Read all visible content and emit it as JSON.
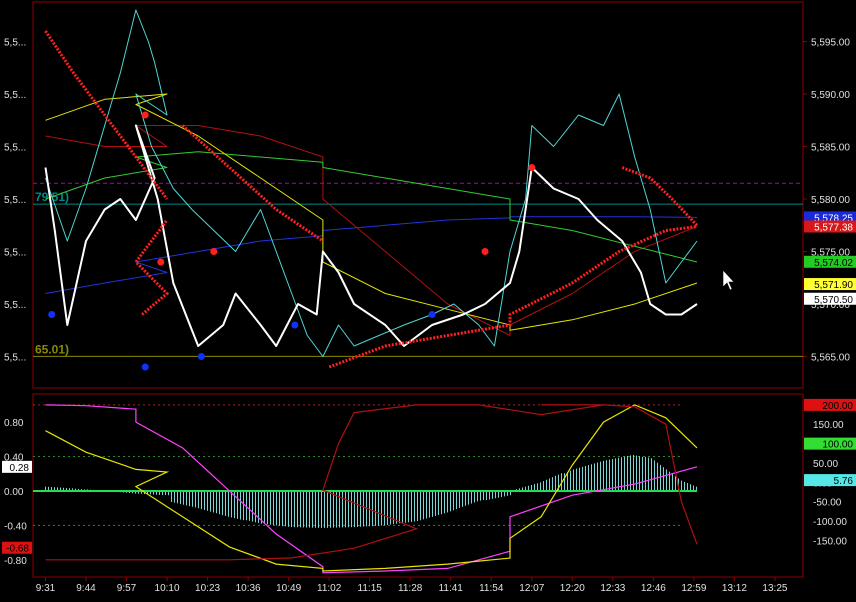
{
  "colors": {
    "background": "#000000",
    "frame": "#8b0000",
    "axis_text": "#e0e0e0",
    "price": "#ffffff",
    "cyan": "#4fd6d6",
    "yellow": "#e6e600",
    "green": "#33cc33",
    "blue": "#2233dd",
    "darkred": "#b01010",
    "red_dots": "#ff2020",
    "blue_dots": "#1030ff",
    "magenta": "#ff40ff",
    "hist": "#7fdede",
    "hline_olive": "#8a8a00",
    "hline_teal": "#008a8a",
    "hline_magenta": "#b000b0",
    "hline_green_dash": "#2a8a2a",
    "hline_red_dash": "#aa2222"
  },
  "chart_data": [
    {
      "panel": "price",
      "type": "line",
      "ylim": [
        5562.0,
        5598.0
      ],
      "right_ticks": [
        "5,595.00",
        "5,590.00",
        "5,585.00",
        "5,580.00",
        "5,575.00",
        "5,570.00",
        "5,565.00"
      ],
      "right_tick_values": [
        5595,
        5590,
        5585,
        5580,
        5575,
        5570,
        5565
      ],
      "left_ticks": [
        "5,5...",
        "5,5...",
        "5,5...",
        "5,5...",
        "5,5...",
        "5,5...",
        "5,5..."
      ],
      "left_tick_values": [
        5595,
        5590,
        5585,
        5580,
        5575,
        5570,
        5565
      ],
      "horizontal_lines": [
        {
          "y": 5565.01,
          "color": "hline_olive",
          "label": "65.01)"
        },
        {
          "y": 5579.51,
          "color": "hline_teal",
          "label": "79.51)"
        },
        {
          "y": 5581.5,
          "color": "hline_magenta",
          "dash": true
        }
      ],
      "value_badges": [
        {
          "text": "5,578.25",
          "bg": "#1a2ad8",
          "fg": "#ffffff",
          "y": 5578.25
        },
        {
          "text": "5,577.38",
          "bg": "#d81818",
          "fg": "#ffffff",
          "y": 5577.38
        },
        {
          "text": "5,574.02",
          "bg": "#22cc22",
          "fg": "#000000",
          "y": 5574.02
        },
        {
          "text": "5,571.90",
          "bg": "#ffff33",
          "fg": "#000000",
          "y": 5571.9
        },
        {
          "text": "5,570.50",
          "bg": "#ffffff",
          "fg": "#000000",
          "y": 5570.5
        }
      ],
      "series": [
        {
          "color": "price",
          "width": 2,
          "x": [
            9.31,
            9.34,
            9.38,
            9.44,
            9.5,
            9.55,
            9.6,
            9.66,
            10.0,
            10.07,
            10.12,
            10.2,
            10.28,
            10.32,
            10.4,
            10.45,
            10.52,
            10.58,
            11.0,
            11.05,
            11.1,
            11.2,
            11.26,
            11.35,
            11.45,
            11.52,
            11.6,
            12.03,
            12.07,
            12.14,
            12.22,
            12.28,
            12.36,
            12.42,
            12.45,
            12.5,
            12.55,
            12.6
          ],
          "y": [
            5583,
            5577,
            5568,
            5576,
            5579,
            5580,
            5578,
            5582,
            5587,
            5580,
            5572,
            5566,
            5568,
            5571,
            5568,
            5566,
            5570,
            5569,
            5575,
            5573,
            5570,
            5568,
            5566,
            5568,
            5569,
            5570,
            5572,
            5575,
            5583,
            5581,
            5580,
            5578,
            5576,
            5573,
            5570,
            5569,
            5569,
            5570
          ]
        },
        {
          "color": "cyan",
          "width": 1,
          "x": [
            9.31,
            9.38,
            9.44,
            9.5,
            9.55,
            9.6,
            9.64,
            9.66,
            9.7,
            10.0,
            10.05,
            10.12,
            10.18,
            10.25,
            10.32,
            10.4,
            10.45,
            10.5,
            10.55,
            11.0,
            11.05,
            11.1,
            11.18,
            11.26,
            11.35,
            11.42,
            11.5,
            11.55,
            12.0,
            12.05,
            12.07,
            12.14,
            12.22,
            12.3,
            12.35,
            12.4,
            12.45,
            12.5,
            12.55,
            12.6
          ],
          "y": [
            5582,
            5576,
            5581,
            5587,
            5592,
            5598,
            5595,
            5593,
            5588,
            5590,
            5585,
            5581,
            5579,
            5577,
            5575,
            5579,
            5575,
            5571,
            5567,
            5565,
            5568,
            5566,
            5567,
            5568,
            5569,
            5570,
            5568,
            5566,
            5575,
            5580,
            5587,
            5585,
            5588,
            5587,
            5590,
            5584,
            5579,
            5572,
            5574,
            5576
          ]
        },
        {
          "color": "yellow",
          "width": 1,
          "x": [
            9.31,
            9.5,
            9.7,
            10.0,
            10.2,
            10.4,
            10.6,
            11.0,
            11.2,
            11.4,
            11.6,
            12.0,
            12.2,
            12.4,
            12.6
          ],
          "y": [
            5587.5,
            5589.5,
            5590,
            5589,
            5586,
            5582,
            5578,
            5574,
            5571,
            5569.5,
            5568,
            5567.5,
            5568.5,
            5570,
            5572
          ]
        },
        {
          "color": "green",
          "width": 1,
          "x": [
            9.31,
            9.5,
            9.7,
            10.0,
            10.2,
            10.4,
            10.6,
            11.0,
            11.2,
            11.4,
            11.6,
            12.0,
            12.2,
            12.4,
            12.6
          ],
          "y": [
            5580,
            5582,
            5583,
            5584,
            5584.5,
            5584,
            5583.5,
            5583,
            5582,
            5581,
            5580,
            5578,
            5577,
            5575.5,
            5574
          ]
        },
        {
          "color": "blue",
          "width": 1,
          "x": [
            9.31,
            9.5,
            9.7,
            10.0,
            10.2,
            10.4,
            10.6,
            11.0,
            11.2,
            11.4,
            11.6,
            12.0,
            12.2,
            12.4,
            12.6
          ],
          "y": [
            5571,
            5572,
            5573,
            5574,
            5575,
            5576,
            5576.5,
            5577,
            5577.5,
            5578,
            5578.2,
            5578.3,
            5578.3,
            5578.3,
            5578.25
          ]
        },
        {
          "color": "darkred",
          "width": 1,
          "x": [
            9.31,
            9.5,
            9.7,
            10.0,
            10.2,
            10.4,
            10.6,
            11.0,
            11.2,
            11.4,
            11.6,
            12.0,
            12.2,
            12.4,
            12.6
          ],
          "y": [
            5586,
            5585,
            5585,
            5587,
            5587,
            5586,
            5584,
            5580,
            5575,
            5570,
            5567,
            5568,
            5571,
            5575,
            5577.38
          ]
        }
      ],
      "markers": {
        "red_trail_a_x": [
          9.31,
          9.4,
          9.5,
          9.6,
          9.7
        ],
        "red_trail_a_y": [
          5596,
          5592,
          5588,
          5584,
          5580
        ],
        "red_trail_b_x": [
          9.62,
          9.7,
          10.0,
          10.1
        ],
        "red_trail_b_y": [
          5569,
          5571,
          5574,
          5578
        ],
        "red_trail_c_x": [
          10.15,
          10.3,
          10.45,
          10.6
        ],
        "red_trail_c_y": [
          5587,
          5583,
          5579,
          5576
        ],
        "red_trail_d_x": [
          11.02,
          11.2,
          11.4,
          11.6,
          12.0,
          12.2,
          12.35,
          12.5,
          12.6
        ],
        "red_trail_d_y": [
          5564,
          5566,
          5567,
          5568,
          5569,
          5572,
          5575,
          5577,
          5577.38
        ],
        "red_trail_e_x": [
          12.36,
          12.45,
          12.52,
          12.6
        ],
        "red_trail_e_y": [
          5583,
          5582,
          5580,
          5577.5
        ],
        "red_dots_x": [
          9.63,
          10.08,
          10.25,
          11.52,
          12.07
        ],
        "red_dots_y": [
          5588,
          5574,
          5575,
          5575,
          5583
        ],
        "blue_dots_x": [
          9.33,
          10.03,
          10.21,
          10.51,
          10.95
        ],
        "blue_dots_y": [
          5569,
          5564,
          5565,
          5568,
          5569
        ]
      }
    },
    {
      "panel": "oscillator",
      "type": "line",
      "ylim": [
        -1.0,
        1.08
      ],
      "left_ticks": [
        "0.80",
        "0.40",
        "0.00",
        "-0.40",
        "-0.80"
      ],
      "left_tick_values": [
        0.8,
        0.4,
        0.0,
        -0.4,
        -0.8
      ],
      "right_ticks": [
        "150.00",
        "100.00",
        "50.00",
        "0.00",
        "-50.00",
        "-100.00",
        "-150.00"
      ],
      "right_tick_values": [
        150,
        100,
        50,
        0,
        -50,
        -100,
        -150
      ],
      "right_range": [
        -200,
        200
      ],
      "left_badges": [
        {
          "text": "0.28",
          "bg": "#ffffff",
          "fg": "#000000",
          "y": 0.28
        },
        {
          "text": "-0.68",
          "bg": "#dd1111",
          "fg": "#000000",
          "y": -0.66
        }
      ],
      "right_badges": [
        {
          "text": "200.00",
          "bg": "#dd1111",
          "fg": "#000000",
          "y": 200
        },
        {
          "text": "100.00",
          "bg": "#33dd33",
          "fg": "#000000",
          "y": 100
        },
        {
          "text": "5.76",
          "bg": "#55e6e6",
          "fg": "#000000",
          "y": 5.76
        }
      ],
      "dashed_lines": [
        {
          "y": 1.0,
          "color": "hline_red_dash"
        },
        {
          "y": 0.4,
          "color": "hline_green_dash"
        },
        {
          "y": 0.0,
          "color": "hline_red_dash"
        },
        {
          "y": -0.4,
          "color": "hline_green_dash"
        }
      ],
      "histogram": {
        "x": [
          9.31,
          9.4,
          9.5,
          9.6,
          9.7,
          10.0,
          10.1,
          10.2,
          10.3,
          10.4,
          10.5,
          10.6,
          11.0,
          11.1,
          11.2,
          11.3,
          11.4,
          11.5,
          11.6,
          12.0,
          12.1,
          12.2,
          12.3,
          12.4,
          12.45,
          12.5,
          12.55,
          12.6
        ],
        "y": [
          0.05,
          0.03,
          0.0,
          -0.03,
          -0.05,
          -0.08,
          -0.12,
          -0.2,
          -0.3,
          -0.38,
          -0.42,
          -0.43,
          -0.43,
          -0.42,
          -0.4,
          -0.35,
          -0.25,
          -0.12,
          -0.05,
          0.0,
          0.1,
          0.25,
          0.35,
          0.42,
          0.38,
          0.25,
          0.12,
          0.05
        ]
      },
      "series": [
        {
          "color": "magenta",
          "x": [
            9.31,
            9.44,
            9.6,
            10.0,
            10.15,
            10.3,
            10.45,
            10.6,
            11.0,
            11.2,
            11.4,
            11.6,
            12.0,
            12.2,
            12.4,
            12.6
          ],
          "y": [
            1.0,
            0.99,
            0.95,
            0.8,
            0.5,
            0.0,
            -0.5,
            -0.88,
            -0.95,
            -0.93,
            -0.9,
            -0.7,
            -0.3,
            -0.05,
            0.08,
            0.28
          ]
        },
        {
          "color": "yellow",
          "x": [
            9.31,
            9.44,
            9.6,
            9.7,
            10.0,
            10.15,
            10.3,
            10.45,
            10.6,
            11.0,
            11.2,
            11.4,
            11.6,
            12.0,
            12.1,
            12.2,
            12.3,
            12.4,
            12.5,
            12.6
          ],
          "y": [
            0.7,
            0.45,
            0.25,
            0.22,
            0.05,
            -0.3,
            -0.65,
            -0.85,
            -0.9,
            -0.93,
            -0.9,
            -0.85,
            -0.78,
            -0.55,
            -0.3,
            0.3,
            0.8,
            1.0,
            0.85,
            0.5
          ]
        },
        {
          "color": "darkred",
          "axis": "right",
          "x": [
            9.31,
            9.6,
            10.0,
            10.3,
            10.5,
            10.7,
            10.9,
            11.0,
            11.05,
            11.1,
            11.3,
            11.5,
            11.7,
            11.9,
            12.1,
            12.3,
            12.4,
            12.5,
            12.55,
            12.6
          ],
          "y": [
            -200,
            -200,
            -200,
            -200,
            -195,
            -170,
            -120,
            -20,
            100,
            180,
            200,
            200,
            175,
            200,
            200,
            200,
            195,
            150,
            -50,
            -160
          ]
        }
      ]
    }
  ],
  "x_axis": {
    "xlim": [
      9.27,
      13.34
    ],
    "ticks": [
      "9:31",
      "9:44",
      "9:57",
      "10:10",
      "10:23",
      "10:36",
      "10:49",
      "11:02",
      "11:15",
      "11:28",
      "11:41",
      "11:54",
      "12:07",
      "12:20",
      "12:33",
      "12:46",
      "12:59",
      "13:12",
      "13:25"
    ],
    "tick_values": [
      9.31,
      9.44,
      9.57,
      10.1,
      10.23,
      10.36,
      10.49,
      11.02,
      11.15,
      11.28,
      11.41,
      11.54,
      12.07,
      12.2,
      12.33,
      12.46,
      12.59,
      13.12,
      13.25
    ]
  }
}
